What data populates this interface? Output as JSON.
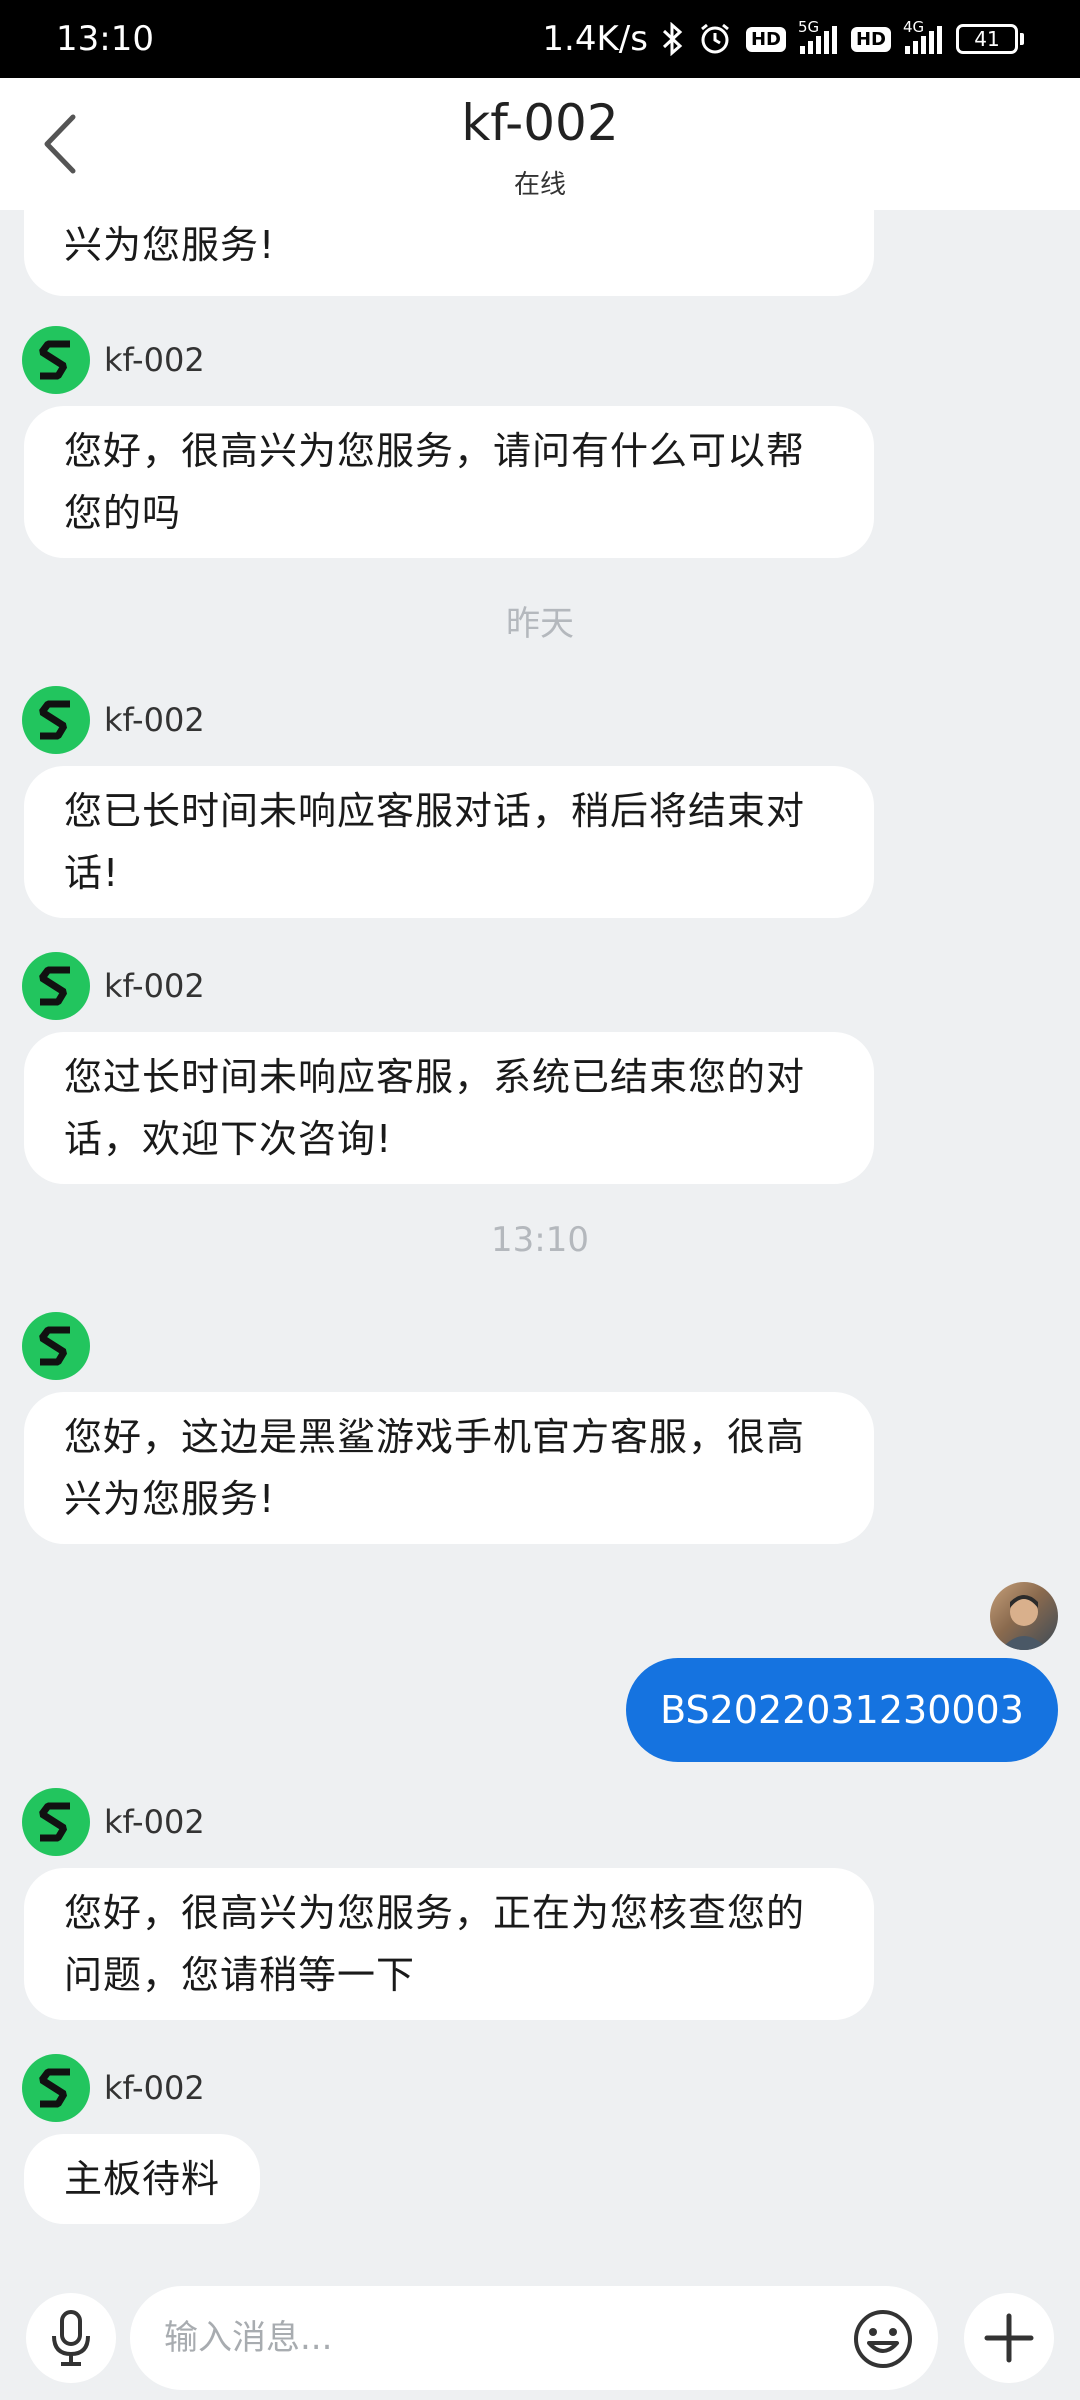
{
  "status_bar": {
    "time": "13:10",
    "speed": "1.4K/s",
    "hd1": "HD",
    "net1": "5G",
    "hd2": "HD",
    "net2": "4G",
    "battery": "41"
  },
  "header": {
    "title": "kf-002",
    "subtitle": "在线"
  },
  "messages": [
    {
      "sender": "",
      "text": "兴为您服务!"
    },
    {
      "sender": "kf-002",
      "text": "您好，很高兴为您服务，请问有什么可以帮您的吗"
    },
    {
      "sender": "kf-002",
      "text": "您已长时间未响应客服对话，稍后将结束对话!"
    },
    {
      "sender": "kf-002",
      "text": "您过长时间未响应客服，系统已结束您的对话，欢迎下次咨询!"
    },
    {
      "sender": "",
      "text": "您好，这边是黑鲨游戏手机官方客服，很高兴为您服务!"
    },
    {
      "sender": "kf-002",
      "text": "您好，很高兴为您服务，正在为您核查您的问题，您请稍等一下"
    },
    {
      "sender": "kf-002",
      "text": "主板待料"
    }
  ],
  "time_separators": [
    "昨天",
    "13:10"
  ],
  "user_message": {
    "text": "BS2022031230003"
  },
  "input": {
    "placeholder": "输入消息..."
  },
  "colors": {
    "accent_logo": "#22c55e",
    "user_bubble": "#1573e0",
    "background": "#eef0f2"
  },
  "icons": [
    "back-arrow-icon",
    "shark-logo-icon",
    "mic-icon",
    "emoji-icon",
    "plus-icon",
    "bluetooth-icon",
    "alarm-icon"
  ]
}
